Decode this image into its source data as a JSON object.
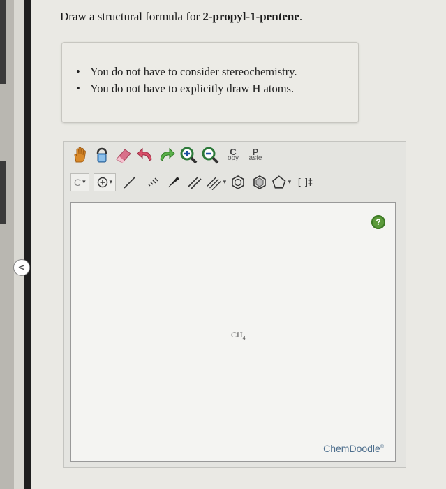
{
  "question": {
    "prefix": "Draw a structural formula for ",
    "compound": "2-propyl-1-pentene",
    "suffix": "."
  },
  "notes": [
    "You do not have to consider stereochemistry.",
    "You do not have to explicitly draw H atoms."
  ],
  "navigation": {
    "back_icon": "chevron-left-icon",
    "back_glyph": "<"
  },
  "toolbar": {
    "row1": [
      "hand-icon",
      "lasso-icon",
      "eraser-icon",
      "undo-icon",
      "redo-icon",
      "zoom-in-icon",
      "zoom-out-icon",
      "copy",
      "paste"
    ],
    "copy_top": "C",
    "copy_bottom": "opy",
    "paste_top": "P",
    "paste_bottom": "aste",
    "element_label": "C",
    "dropdown_glyph": "▾",
    "bracket_label": "[ ]‡",
    "row2": [
      "element-select",
      "charge-plus-icon",
      "single-bond-icon",
      "hashed-bond-icon",
      "wedge-bond-icon",
      "double-bond-icon",
      "triple-bond-icon",
      "benzene-icon",
      "cyclohexane-icon",
      "pentagon-icon",
      "bracket-icon"
    ]
  },
  "canvas": {
    "molecule_main": "CH",
    "molecule_sub": "4",
    "help_label": "?",
    "brand": "ChemDoodle",
    "brand_mark": "®"
  },
  "colors": {
    "help": "#5b9a3a",
    "brand": "#4d6e8d",
    "hand": "#d98a2a",
    "eraser": "#d9708a",
    "undo": "#d9506a",
    "redo": "#5ab04a",
    "zoom": "#2d7a3a"
  }
}
